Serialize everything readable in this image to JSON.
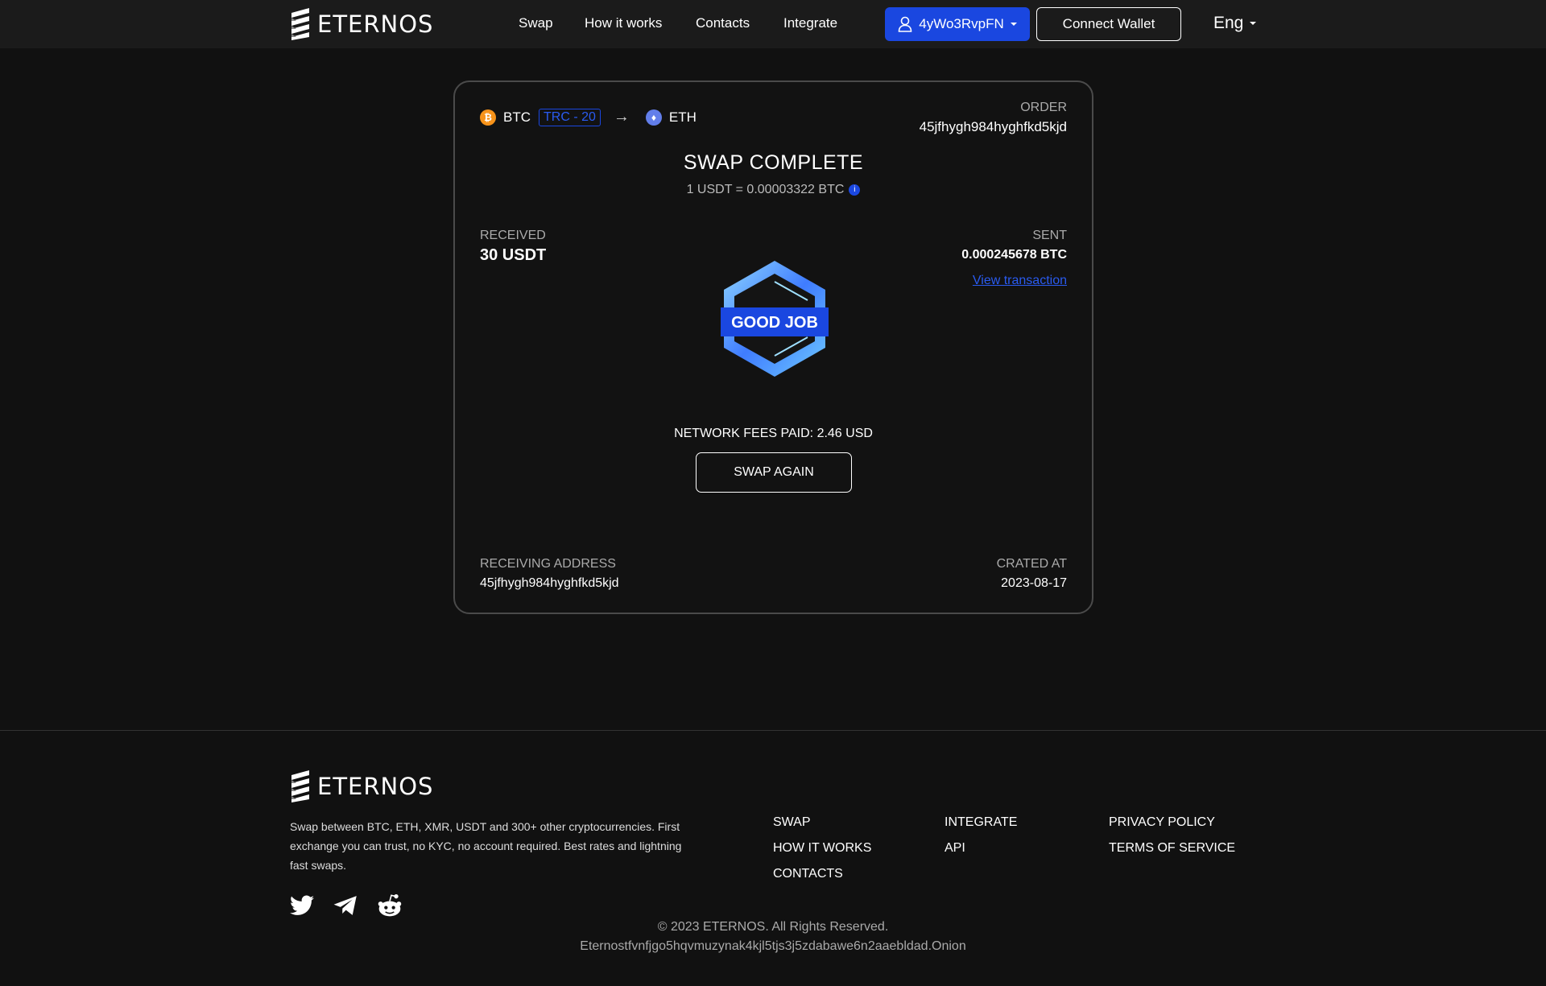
{
  "header": {
    "logo_text": "ETERNOS",
    "nav": [
      "Swap",
      "How it works",
      "Contacts",
      "Integrate"
    ],
    "user_button": "4yWo3RvpFN",
    "connect_button": "Connect Wallet",
    "language": "Eng"
  },
  "swap": {
    "from_coin": "BTC",
    "from_network": "TRC - 20",
    "arrow": "→",
    "to_coin": "ETH",
    "order_label": "ORDER",
    "order_id": "45jfhygh984hyghfkd5kjd",
    "title": "SWAP COMPLETE",
    "rate": "1 USDT = 0.00003322 BTC",
    "received_label": "RECEIVED",
    "received_value": "30 USDT",
    "sent_label": "SENT",
    "sent_value": "0.000245678 BTC",
    "view_transaction": "View transaction",
    "badge_text": "GOOD JOB",
    "fees": "NETWORK FEES PAID: 2.46 USD",
    "swap_again": "SWAP AGAIN",
    "address_label": "RECEIVING ADDRESS",
    "address_value": "45jfhygh984hyghfkd5kjd",
    "created_label": "CRATED AT",
    "created_value": "2023-08-17"
  },
  "footer": {
    "logo_text": "ETERNOS",
    "description": "Swap between BTC, ETH, XMR, USDT and 300+ other cryptocurrencies. First exchange you can trust, no KYC, no account required. Best rates and lightning fast swaps.",
    "links_col1": [
      "SWAP",
      "HOW IT WORKS",
      "CONTACTS"
    ],
    "links_col2": [
      "INTEGRATE",
      "API"
    ],
    "links_col3": [
      "PRIVACY POLICY",
      "TERMS OF SERVICE"
    ],
    "socials": [
      "twitter-icon",
      "telegram-icon",
      "reddit-icon"
    ],
    "copyright": "© 2023 ETERNOS. All Rights Reserved.",
    "onion": "Eternostfvnfjgo5hqvmuzynak4kjl5tjs3j5zdabawe6n2aaebldad.Onion"
  },
  "colors": {
    "background": "#111111",
    "header_bg": "#1b1b1b",
    "accent": "#1a47e0",
    "btc": "#f7931a",
    "eth": "#627eea"
  }
}
